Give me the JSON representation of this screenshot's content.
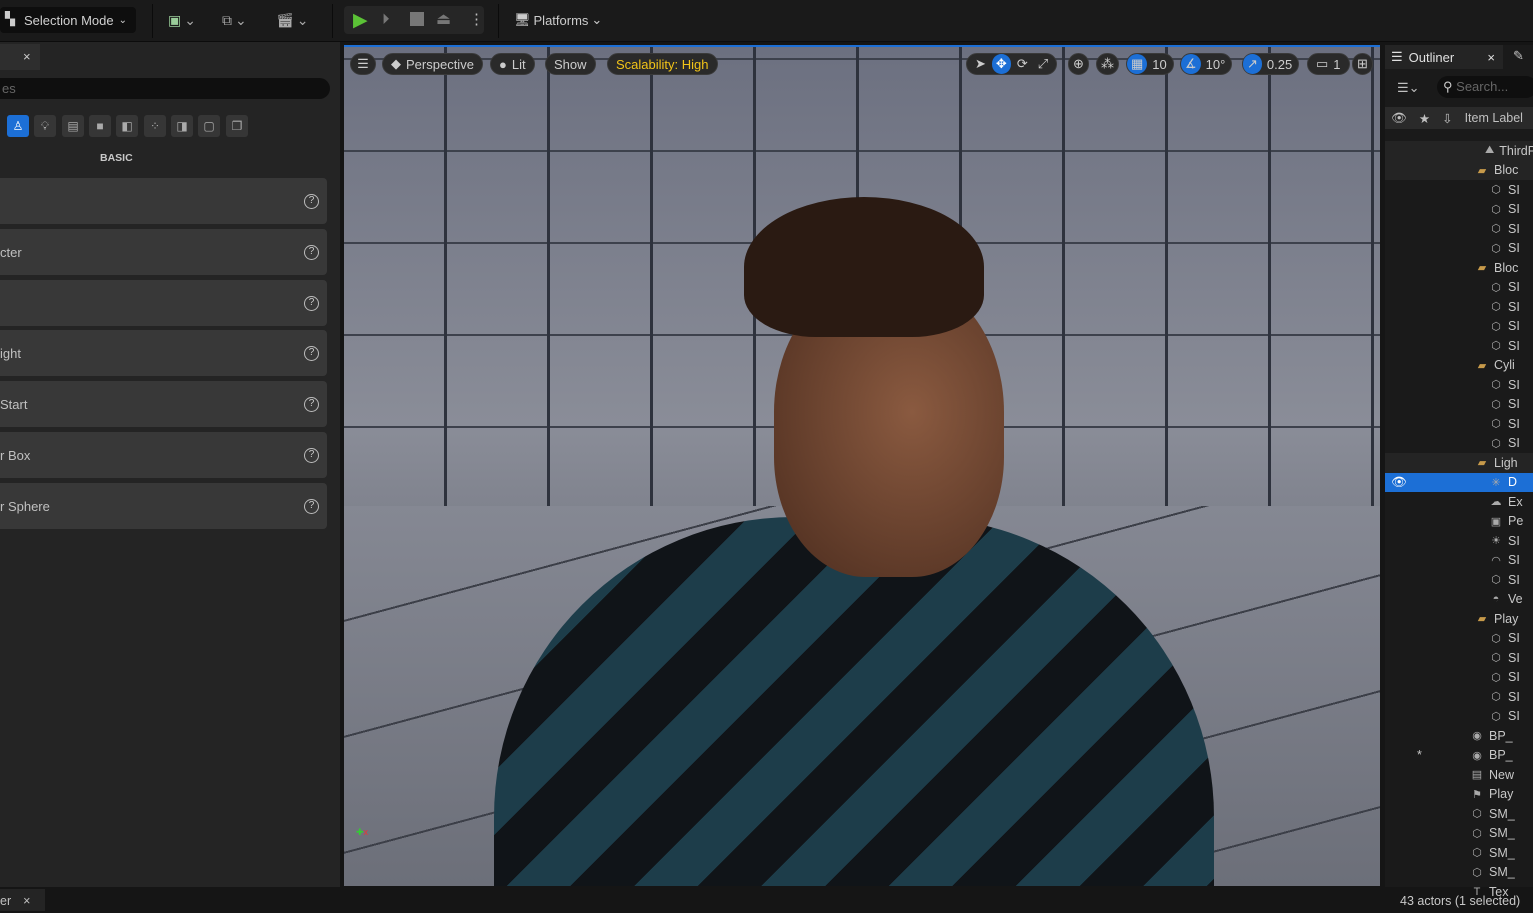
{
  "toolbar": {
    "selection_mode": "Selection Mode",
    "platforms": "Platforms"
  },
  "left_panel": {
    "search_placeholder": "es",
    "category": "BASIC",
    "items": [
      "",
      "cter",
      "",
      "ight",
      " Start",
      "r Box",
      "r Sphere"
    ],
    "bottom_tab": "er"
  },
  "viewport": {
    "menu": "Perspective",
    "lit": "Lit",
    "show": "Show",
    "scalability": "Scalability: High",
    "grid_snap": "10",
    "rot_snap": "10°",
    "scale_snap": "0.25",
    "camera_speed": "1"
  },
  "outliner": {
    "title": "Outliner",
    "search_placeholder": "Search...",
    "column": "Item Label",
    "rows": [
      {
        "label": "ThirdP",
        "icon": "level",
        "indent": 0
      },
      {
        "label": "Bloc",
        "icon": "folder",
        "indent": 1
      },
      {
        "label": "SI",
        "icon": "mesh",
        "indent": 2
      },
      {
        "label": "SI",
        "icon": "mesh",
        "indent": 2
      },
      {
        "label": "SI",
        "icon": "mesh",
        "indent": 2
      },
      {
        "label": "SI",
        "icon": "mesh",
        "indent": 2
      },
      {
        "label": "Bloc",
        "icon": "folder",
        "indent": 1
      },
      {
        "label": "SI",
        "icon": "mesh",
        "indent": 2
      },
      {
        "label": "SI",
        "icon": "mesh",
        "indent": 2
      },
      {
        "label": "SI",
        "icon": "mesh",
        "indent": 2
      },
      {
        "label": "SI",
        "icon": "mesh",
        "indent": 2
      },
      {
        "label": "Cyli",
        "icon": "folder",
        "indent": 1
      },
      {
        "label": "SI",
        "icon": "mesh",
        "indent": 2
      },
      {
        "label": "SI",
        "icon": "mesh",
        "indent": 2
      },
      {
        "label": "SI",
        "icon": "mesh",
        "indent": 2
      },
      {
        "label": "SI",
        "icon": "mesh",
        "indent": 2
      },
      {
        "label": "Ligh",
        "icon": "folder",
        "indent": 1
      },
      {
        "label": "D",
        "icon": "light",
        "indent": 2,
        "selected": true
      },
      {
        "label": "Ex",
        "icon": "fog",
        "indent": 2
      },
      {
        "label": "Pe",
        "icon": "volume",
        "indent": 2
      },
      {
        "label": "SI",
        "icon": "sky",
        "indent": 2
      },
      {
        "label": "SI",
        "icon": "skylight",
        "indent": 2
      },
      {
        "label": "SI",
        "icon": "mesh",
        "indent": 2
      },
      {
        "label": "Ve",
        "icon": "cloud",
        "indent": 2
      },
      {
        "label": "Play",
        "icon": "folder",
        "indent": 1
      },
      {
        "label": "SI",
        "icon": "mesh",
        "indent": 2
      },
      {
        "label": "SI",
        "icon": "mesh",
        "indent": 2
      },
      {
        "label": "SI",
        "icon": "mesh",
        "indent": 2
      },
      {
        "label": "SI",
        "icon": "mesh",
        "indent": 2
      },
      {
        "label": "SI",
        "icon": "mesh",
        "indent": 2
      },
      {
        "label": "BP_",
        "icon": "bp",
        "indent": 1
      },
      {
        "label": "BP_",
        "icon": "bp",
        "indent": 1,
        "starred": true
      },
      {
        "label": "New",
        "icon": "sequence",
        "indent": 1
      },
      {
        "label": "Play",
        "icon": "playerstart",
        "indent": 1
      },
      {
        "label": "SM_",
        "icon": "mesh",
        "indent": 1
      },
      {
        "label": "SM_",
        "icon": "mesh",
        "indent": 1
      },
      {
        "label": "SM_",
        "icon": "mesh",
        "indent": 1
      },
      {
        "label": "SM_",
        "icon": "mesh",
        "indent": 1
      },
      {
        "label": "Tex",
        "icon": "text",
        "indent": 1
      }
    ],
    "status": "43 actors (1 selected)"
  },
  "colors": {
    "accent": "#1c6fd6",
    "play": "#5bc236",
    "scalability": "#f2c418"
  }
}
